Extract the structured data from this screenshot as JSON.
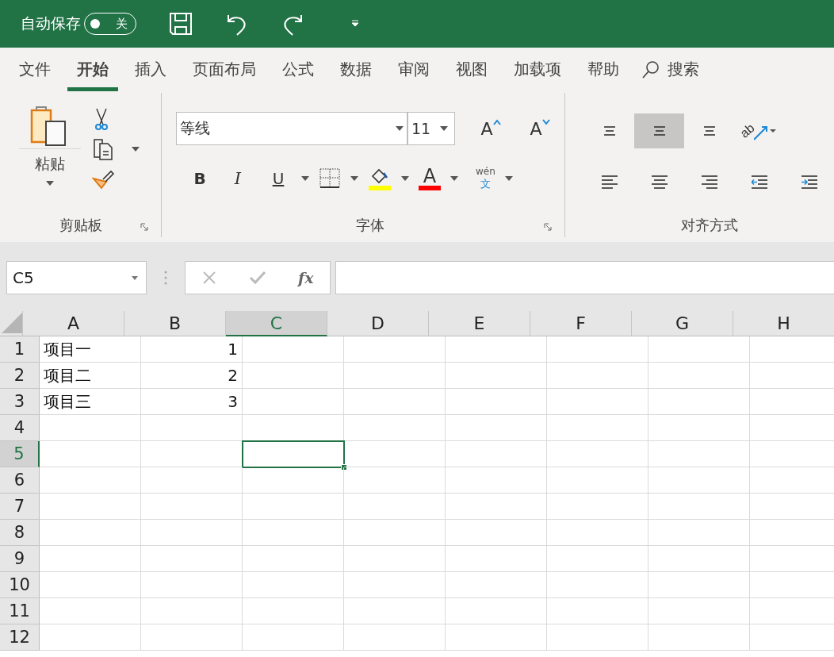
{
  "title_bar": {
    "autosave_label": "自动保存",
    "autosave": {
      "on": false,
      "label": "关"
    }
  },
  "tabs": [
    {
      "label": "文件",
      "selected": false
    },
    {
      "label": "开始",
      "selected": true
    },
    {
      "label": "插入",
      "selected": false
    },
    {
      "label": "页面布局",
      "selected": false
    },
    {
      "label": "公式",
      "selected": false
    },
    {
      "label": "数据",
      "selected": false
    },
    {
      "label": "审阅",
      "selected": false
    },
    {
      "label": "视图",
      "selected": false
    },
    {
      "label": "加载项",
      "selected": false
    },
    {
      "label": "帮助",
      "selected": false
    }
  ],
  "search": {
    "label": "搜索"
  },
  "ribbon": {
    "clipboard": {
      "paste": "粘贴",
      "group_label": "剪贴板"
    },
    "font": {
      "font_name": "等线",
      "font_size": "11",
      "grow": "A",
      "shrink": "A",
      "bold": "B",
      "italic": "I",
      "underline": "U",
      "font_color": "A",
      "phonetic_top": "wén",
      "phonetic_bottom": "文",
      "group_label": "字体"
    },
    "alignment": {
      "group_label": "对齐方式",
      "orientation_label": "ab",
      "rows": [
        [
          {
            "kind": "top",
            "selected": false
          },
          {
            "kind": "middle",
            "selected": true
          },
          {
            "kind": "bottom",
            "selected": false
          },
          {
            "kind": "orientation",
            "selected": false
          }
        ],
        [
          {
            "kind": "left",
            "selected": false
          },
          {
            "kind": "center",
            "selected": false
          },
          {
            "kind": "right",
            "selected": false
          },
          {
            "kind": "outdent",
            "selected": false
          },
          {
            "kind": "indent",
            "selected": false
          }
        ]
      ]
    }
  },
  "formula_bar": {
    "name_box": "C5",
    "fx": "fx"
  },
  "sheet": {
    "columns": [
      {
        "label": "A",
        "selected": false
      },
      {
        "label": "B",
        "selected": false
      },
      {
        "label": "C",
        "selected": true
      },
      {
        "label": "D",
        "selected": false
      },
      {
        "label": "E",
        "selected": false
      },
      {
        "label": "F",
        "selected": false
      },
      {
        "label": "G",
        "selected": false
      },
      {
        "label": "H",
        "selected": false
      }
    ],
    "rows": [
      {
        "label": "1",
        "selected": false,
        "cells": [
          "项目一",
          "1",
          "",
          "",
          "",
          "",
          "",
          ""
        ]
      },
      {
        "label": "2",
        "selected": false,
        "cells": [
          "项目二",
          "2",
          "",
          "",
          "",
          "",
          "",
          ""
        ]
      },
      {
        "label": "3",
        "selected": false,
        "cells": [
          "项目三",
          "3",
          "",
          "",
          "",
          "",
          "",
          ""
        ]
      },
      {
        "label": "4",
        "selected": false,
        "cells": [
          "",
          "",
          "",
          "",
          "",
          "",
          "",
          ""
        ]
      },
      {
        "label": "5",
        "selected": true,
        "cells": [
          "",
          "",
          "",
          "",
          "",
          "",
          "",
          ""
        ]
      },
      {
        "label": "6",
        "selected": false,
        "cells": [
          "",
          "",
          "",
          "",
          "",
          "",
          "",
          ""
        ]
      },
      {
        "label": "7",
        "selected": false,
        "cells": [
          "",
          "",
          "",
          "",
          "",
          "",
          "",
          ""
        ]
      },
      {
        "label": "8",
        "selected": false,
        "cells": [
          "",
          "",
          "",
          "",
          "",
          "",
          "",
          ""
        ]
      },
      {
        "label": "9",
        "selected": false,
        "cells": [
          "",
          "",
          "",
          "",
          "",
          "",
          "",
          ""
        ]
      },
      {
        "label": "10",
        "selected": false,
        "cells": [
          "",
          "",
          "",
          "",
          "",
          "",
          "",
          ""
        ]
      },
      {
        "label": "11",
        "selected": false,
        "cells": [
          "",
          "",
          "",
          "",
          "",
          "",
          "",
          ""
        ]
      },
      {
        "label": "12",
        "selected": false,
        "cells": [
          "",
          "",
          "",
          "",
          "",
          "",
          "",
          ""
        ]
      }
    ]
  }
}
